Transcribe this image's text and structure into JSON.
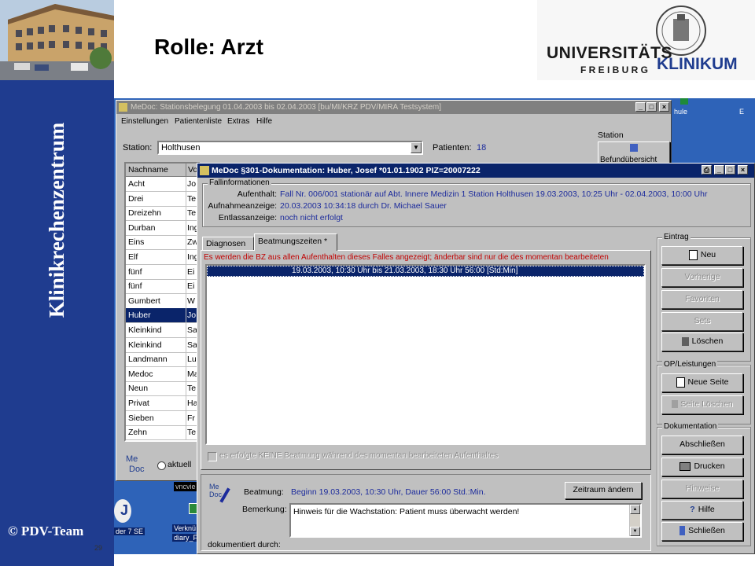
{
  "slide": {
    "title": "Rolle: Arzt",
    "side_title": "Klinikrechenzentrum",
    "footer": "© PDV-Team",
    "page_number": "29"
  },
  "logo": {
    "line1": "UNIVERSITÄTS",
    "line2": "KLINIKUM",
    "line3": "F R E I B U R G"
  },
  "bg_window": {
    "title": "MeDoc: Stationsbelegung 01.04.2003 bis 02.04.2003  [bu/MI/KRZ PDV/MIRA Testsystem]",
    "menu": [
      "Einstellungen",
      "Patientenliste",
      "Extras",
      "Hilfe"
    ],
    "station_label": "Station:",
    "station_value": "Holthusen",
    "patients_label": "Patienten:",
    "patients_count": "18",
    "station_group": "Station",
    "befund_button": "Befundübersicht",
    "columns": [
      "Nachname",
      "Vo"
    ],
    "rows": [
      {
        "name": "Acht",
        "first": "Jo"
      },
      {
        "name": "Drei",
        "first": "Te"
      },
      {
        "name": "Dreizehn",
        "first": "Te"
      },
      {
        "name": "Durban",
        "first": "Ing"
      },
      {
        "name": "Eins",
        "first": "Zw"
      },
      {
        "name": "Elf",
        "first": "Ing"
      },
      {
        "name": "fünf",
        "first": "Ei"
      },
      {
        "name": "fünf",
        "first": "Ei"
      },
      {
        "name": "Gumbert",
        "first": "W"
      },
      {
        "name": "Huber",
        "first": "Jo"
      },
      {
        "name": "Kleinkind",
        "first": "Sa"
      },
      {
        "name": "Kleinkind",
        "first": "Sa"
      },
      {
        "name": "Landmann",
        "first": "Lu"
      },
      {
        "name": "Medoc",
        "first": "Ma"
      },
      {
        "name": "Neun",
        "first": "Te"
      },
      {
        "name": "Privat",
        "first": "Ha"
      },
      {
        "name": "Sieben",
        "first": "Fr"
      },
      {
        "name": "Zehn",
        "first": "Te"
      }
    ],
    "selected_row": "Huber",
    "medoc_logo_top": "Me",
    "medoc_logo_bottom": "Doc",
    "radio_label": "aktuell"
  },
  "taskbar_fragments": {
    "right_top_1": "hule",
    "right_top_2": "E",
    "vnc": "vncvie",
    "left_bottom": "der 7 SE",
    "shortcut_1": "Verknü",
    "shortcut_2": "diary_F"
  },
  "doc_window": {
    "title": "MeDoc §301-Dokumentation: Huber, Josef *01.01.1902 PIZ=20007222",
    "fallinfo_group": "Fallinformationen",
    "aufenthalt_label": "Aufenthalt:",
    "aufenthalt_value": "Fall Nr. 006/001 stationär auf Abt. Innere Medizin 1 Station Holthusen 19.03.2003, 10:25 Uhr - 02.04.2003, 10:00 Uhr",
    "aufnahme_label": "Aufnahmeanzeige:",
    "aufnahme_value": "20.03.2003 10:34:18 durch Dr. Michael Sauer",
    "entlass_label": "Entlassanzeige:",
    "entlass_value": "noch nicht erfolgt",
    "tabs": [
      "Diagnosen",
      "Beatmungszeiten *"
    ],
    "warning": "Es werden die BZ aus allen Aufenthalten dieses Falles angezeigt; änderbar sind  nur die des momentan bearbeiteten",
    "bz_row": "19.03.2003, 10:30 Uhr   bis   21.03.2003, 18:30 Uhr     56:00 [Std:Min]",
    "keine_checkbox": "es erfolgte KEINE Beatmung während des momentan bearbeiteten Aufenthaltes",
    "eintrag_group": "Eintrag",
    "eintrag_buttons": [
      {
        "label": "Neu",
        "enabled": true
      },
      {
        "label": "Vorherige",
        "enabled": false
      },
      {
        "label": "Favoriten",
        "enabled": false
      },
      {
        "label": "Sets",
        "enabled": false
      },
      {
        "label": "Löschen",
        "enabled": true
      }
    ],
    "op_group": "OP/Leistungen",
    "op_buttons": [
      {
        "label": "Neue Seite",
        "enabled": true
      },
      {
        "label": "Seite Löschen",
        "enabled": false
      }
    ],
    "doku_group": "Dokumentation",
    "doku_buttons": [
      {
        "label": "Abschließen",
        "enabled": true
      },
      {
        "label": "Drucken",
        "enabled": true
      },
      {
        "label": "Hinweise",
        "enabled": false
      },
      {
        "label": "Hilfe",
        "enabled": true
      },
      {
        "label": "Schließen",
        "enabled": true
      }
    ],
    "beatmung_label": "Beatmung:",
    "beatmung_value": "Beginn 19.03.2003, 10:30 Uhr, Dauer 56:00 Std.:Min.",
    "zeitraum_button": "Zeitraum ändern",
    "bemerkung_label": "Bemerkung:",
    "bemerkung_value": "Hinweis für die Wachstation:   Patient muss überwacht werden!",
    "dokumentiert_label": "dokumentiert durch:"
  },
  "colors": {
    "slide_band": "#1f3c8f",
    "active_title": "#0a246a",
    "inactive_title": "#808080",
    "window_face": "#c0c0c0",
    "warning_red": "#c00000",
    "value_blue": "#1c2b9c"
  }
}
